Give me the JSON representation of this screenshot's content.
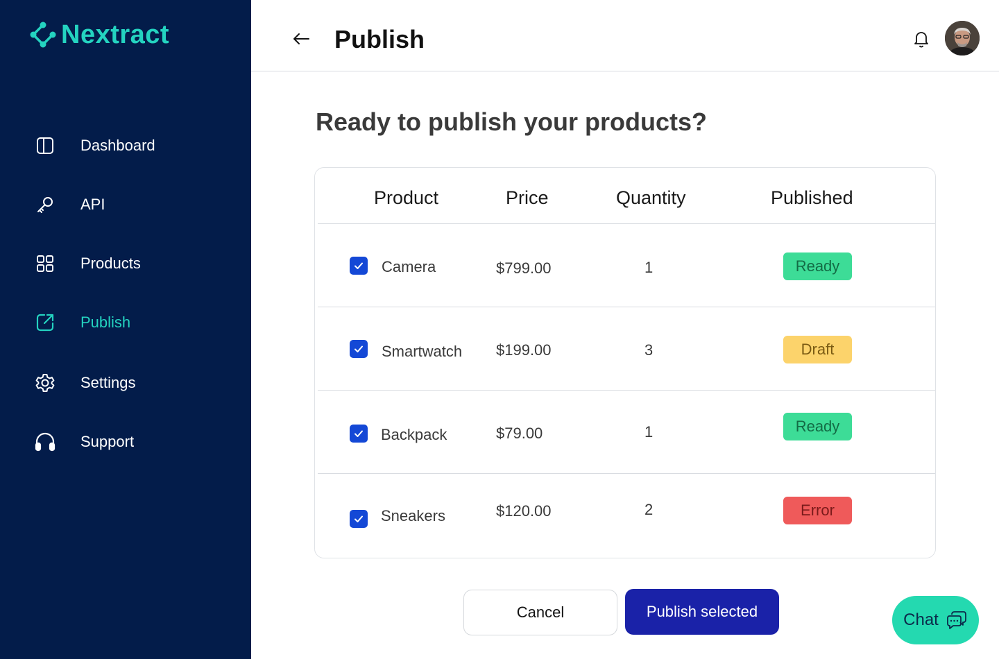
{
  "brand": {
    "name": "Nextract",
    "accent": "#24d3c0",
    "sidebar_bg": "#031c4a"
  },
  "sidebar": {
    "items": [
      {
        "label": "Dashboard",
        "icon": "dashboard-icon",
        "active": false
      },
      {
        "label": "API",
        "icon": "key-icon",
        "active": false
      },
      {
        "label": "Products",
        "icon": "grid-icon",
        "active": false
      },
      {
        "label": "Publish",
        "icon": "external-link-icon",
        "active": true
      },
      {
        "label": "Settings",
        "icon": "gear-icon",
        "active": false
      },
      {
        "label": "Support",
        "icon": "headphones-icon",
        "active": false
      }
    ]
  },
  "header": {
    "title": "Publish",
    "back_icon": "arrow-left-icon",
    "bell_icon": "bell-icon"
  },
  "main": {
    "heading": "Ready to publish your products?",
    "table": {
      "columns": [
        "Product",
        "Price",
        "Quantity",
        "Published"
      ],
      "rows": [
        {
          "product": "Camera",
          "price": "$799.00",
          "quantity": "1",
          "status": "Ready",
          "checked": true
        },
        {
          "product": "Smartwatch",
          "price": "$199.00",
          "quantity": "3",
          "status": "Draft",
          "checked": true
        },
        {
          "product": "Backpack",
          "price": "$79.00",
          "quantity": "1",
          "status": "Ready",
          "checked": true
        },
        {
          "product": "Sneakers",
          "price": "$120.00",
          "quantity": "2",
          "status": "Error",
          "checked": true
        }
      ]
    },
    "status_colors": {
      "Ready": "#3ddc97",
      "Draft": "#fcd36b",
      "Error": "#ef5a5a"
    }
  },
  "actions": {
    "cancel_label": "Cancel",
    "publish_label": "Publish selected"
  },
  "chat": {
    "label": "Chat",
    "icon": "chat-icon",
    "color": "#24d9b0"
  }
}
